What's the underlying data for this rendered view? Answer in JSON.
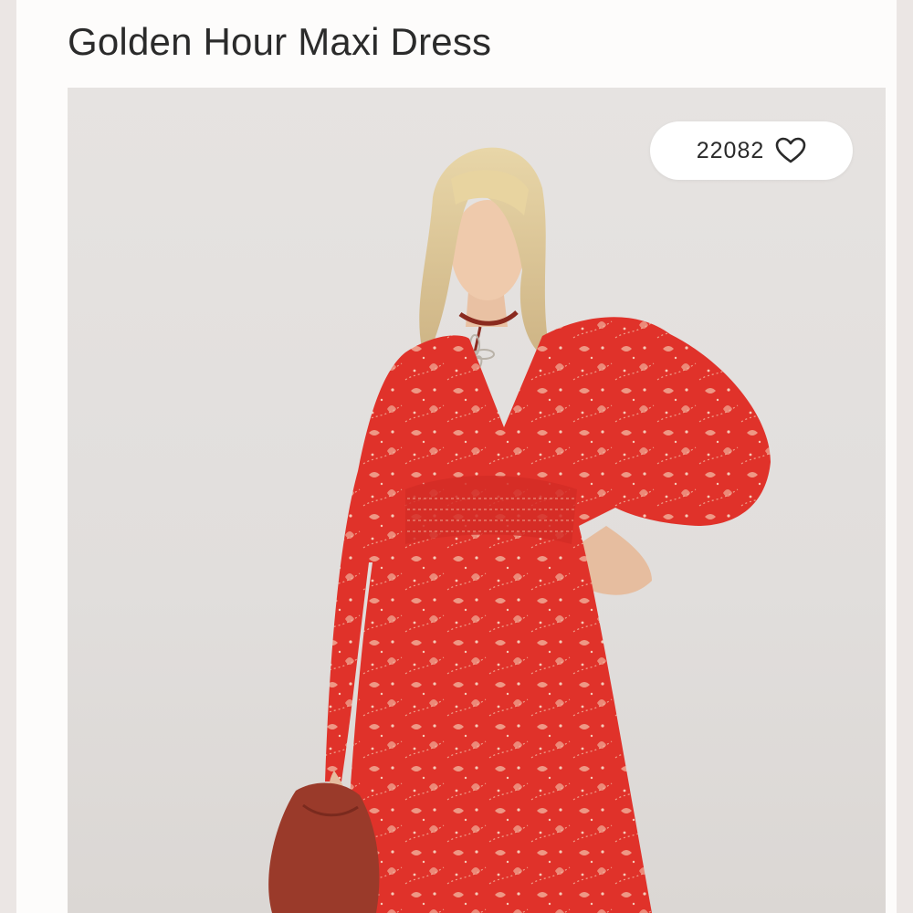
{
  "product": {
    "title": "Golden Hour Maxi Dress",
    "likes": "22082"
  },
  "icons": {
    "like": "heart-outline-icon"
  },
  "colors": {
    "page_background": "#ebe6e4",
    "card_background": "#fdfcfb",
    "photo_background": "#e3e0de",
    "dress_red": "#e0322a",
    "title_text": "#2b2b2b"
  }
}
